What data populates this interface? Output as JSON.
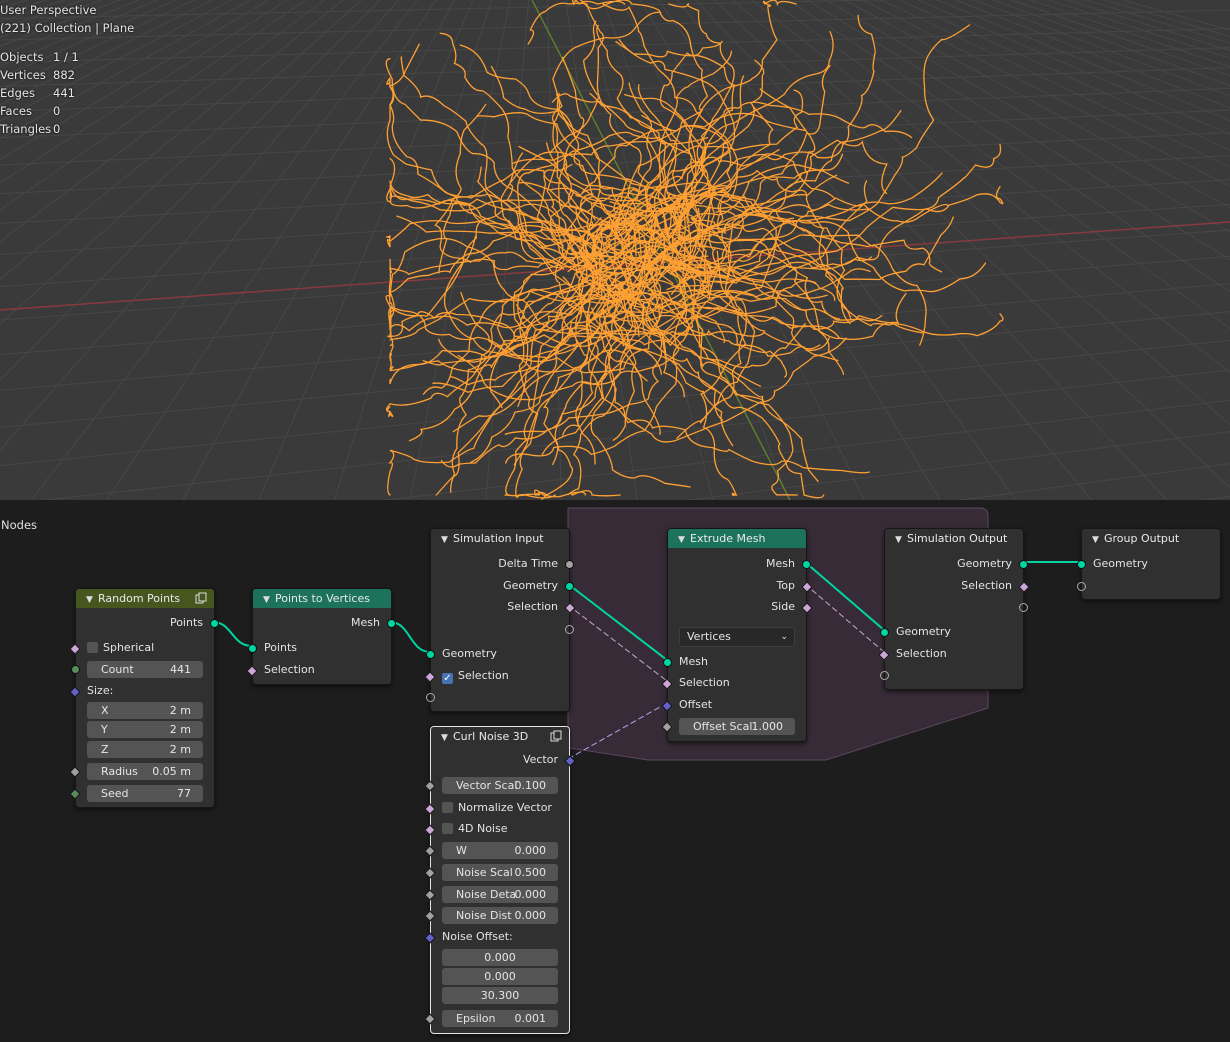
{
  "viewport": {
    "title": "User Perspective",
    "collection": "(221) Collection | Plane",
    "stats": [
      {
        "label": "Objects",
        "value": "1 / 1"
      },
      {
        "label": "Vertices",
        "value": "882"
      },
      {
        "label": "Edges",
        "value": "441"
      },
      {
        "label": "Faces",
        "value": "0"
      },
      {
        "label": "Triangles",
        "value": "0"
      }
    ]
  },
  "editor": {
    "label": "Nodes"
  },
  "nodes": {
    "random_points": {
      "title": "Random Points",
      "out_points": "Points",
      "spherical": "Spherical",
      "count_label": "Count",
      "count_value": "441",
      "size_label": "Size:",
      "x_label": "X",
      "x_value": "2 m",
      "y_label": "Y",
      "y_value": "2 m",
      "z_label": "Z",
      "z_value": "2 m",
      "radius_label": "Radius",
      "radius_value": "0.05 m",
      "seed_label": "Seed",
      "seed_value": "77"
    },
    "points_to_vertices": {
      "title": "Points to Vertices",
      "out_mesh": "Mesh",
      "in_points": "Points",
      "in_selection": "Selection"
    },
    "simulation_input": {
      "title": "Simulation Input",
      "out_delta_time": "Delta Time",
      "out_geometry": "Geometry",
      "out_selection": "Selection",
      "in_geometry": "Geometry",
      "in_selection": "Selection"
    },
    "extrude_mesh": {
      "title": "Extrude Mesh",
      "out_mesh": "Mesh",
      "out_top": "Top",
      "out_side": "Side",
      "mode": "Vertices",
      "in_mesh": "Mesh",
      "in_selection": "Selection",
      "in_offset": "Offset",
      "offset_scale_label": "Offset Scal",
      "offset_scale_value": "1.000"
    },
    "simulation_output": {
      "title": "Simulation Output",
      "out_geometry": "Geometry",
      "out_selection": "Selection",
      "in_geometry": "Geometry",
      "in_selection": "Selection"
    },
    "group_output": {
      "title": "Group Output",
      "in_geometry": "Geometry"
    },
    "curl_noise": {
      "title": "Curl Noise 3D",
      "out_vector": "Vector",
      "vector_scale_label": "Vector Scal",
      "vector_scale_value": "0.100",
      "normalize": "Normalize Vector",
      "noise_4d": "4D Noise",
      "w_label": "W",
      "w_value": "0.000",
      "noise_scale_label": "Noise Scal",
      "noise_scale_value": "0.500",
      "noise_detail_label": "Noise Deta",
      "noise_detail_value": "0.000",
      "noise_dist_label": "Noise Dist",
      "noise_dist_value": "0.000",
      "noise_offset_label": "Noise Offset:",
      "offset_x": "0.000",
      "offset_y": "0.000",
      "offset_z": "30.300",
      "epsilon_label": "Epsilon",
      "epsilon_value": "0.001"
    }
  },
  "colors": {
    "geometry_header": "#1d725e",
    "input_header": "#46561f",
    "geometry_socket": "#00d6a3",
    "boolean_socket": "#cca6d6",
    "vector_socket": "#6363c7",
    "curve_wire": "#ffa033",
    "simulation_zone": "#3b2d3b"
  }
}
